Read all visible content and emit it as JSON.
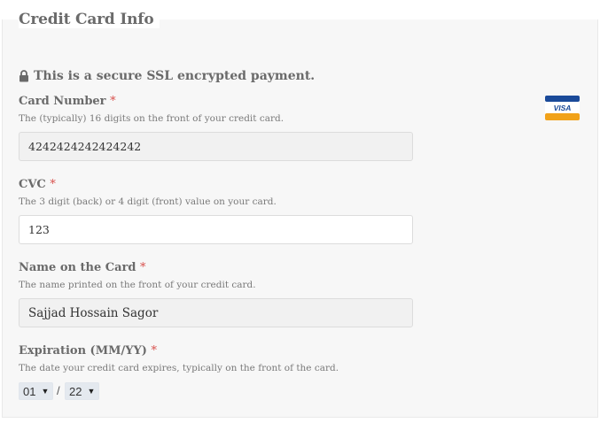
{
  "section": {
    "title": "Credit Card Info"
  },
  "secure_note": "This is a secure SSL encrypted payment.",
  "card_brand_icon": "visa-card-icon",
  "fields": {
    "card_number": {
      "label": "Card Number",
      "required_mark": "*",
      "description": "The (typically) 16 digits on the front of your credit card.",
      "value": "4242424242424242"
    },
    "cvc": {
      "label": "CVC",
      "required_mark": "*",
      "description": "The 3 digit (back) or 4 digit (front) value on your card.",
      "value": "123"
    },
    "name_on_card": {
      "label": "Name on the Card",
      "required_mark": "*",
      "description": "The name printed on the front of your credit card.",
      "value": "Sajjad Hossain Sagor"
    },
    "expiration": {
      "label": "Expiration (MM/YY)",
      "required_mark": "*",
      "description": "The date your credit card expires, typically on the front of the card.",
      "month": "01",
      "separator": "/",
      "year": "22"
    }
  },
  "colors": {
    "required": "#d9534f",
    "visa_blue": "#1a4a99",
    "visa_orange": "#f1a21a"
  }
}
